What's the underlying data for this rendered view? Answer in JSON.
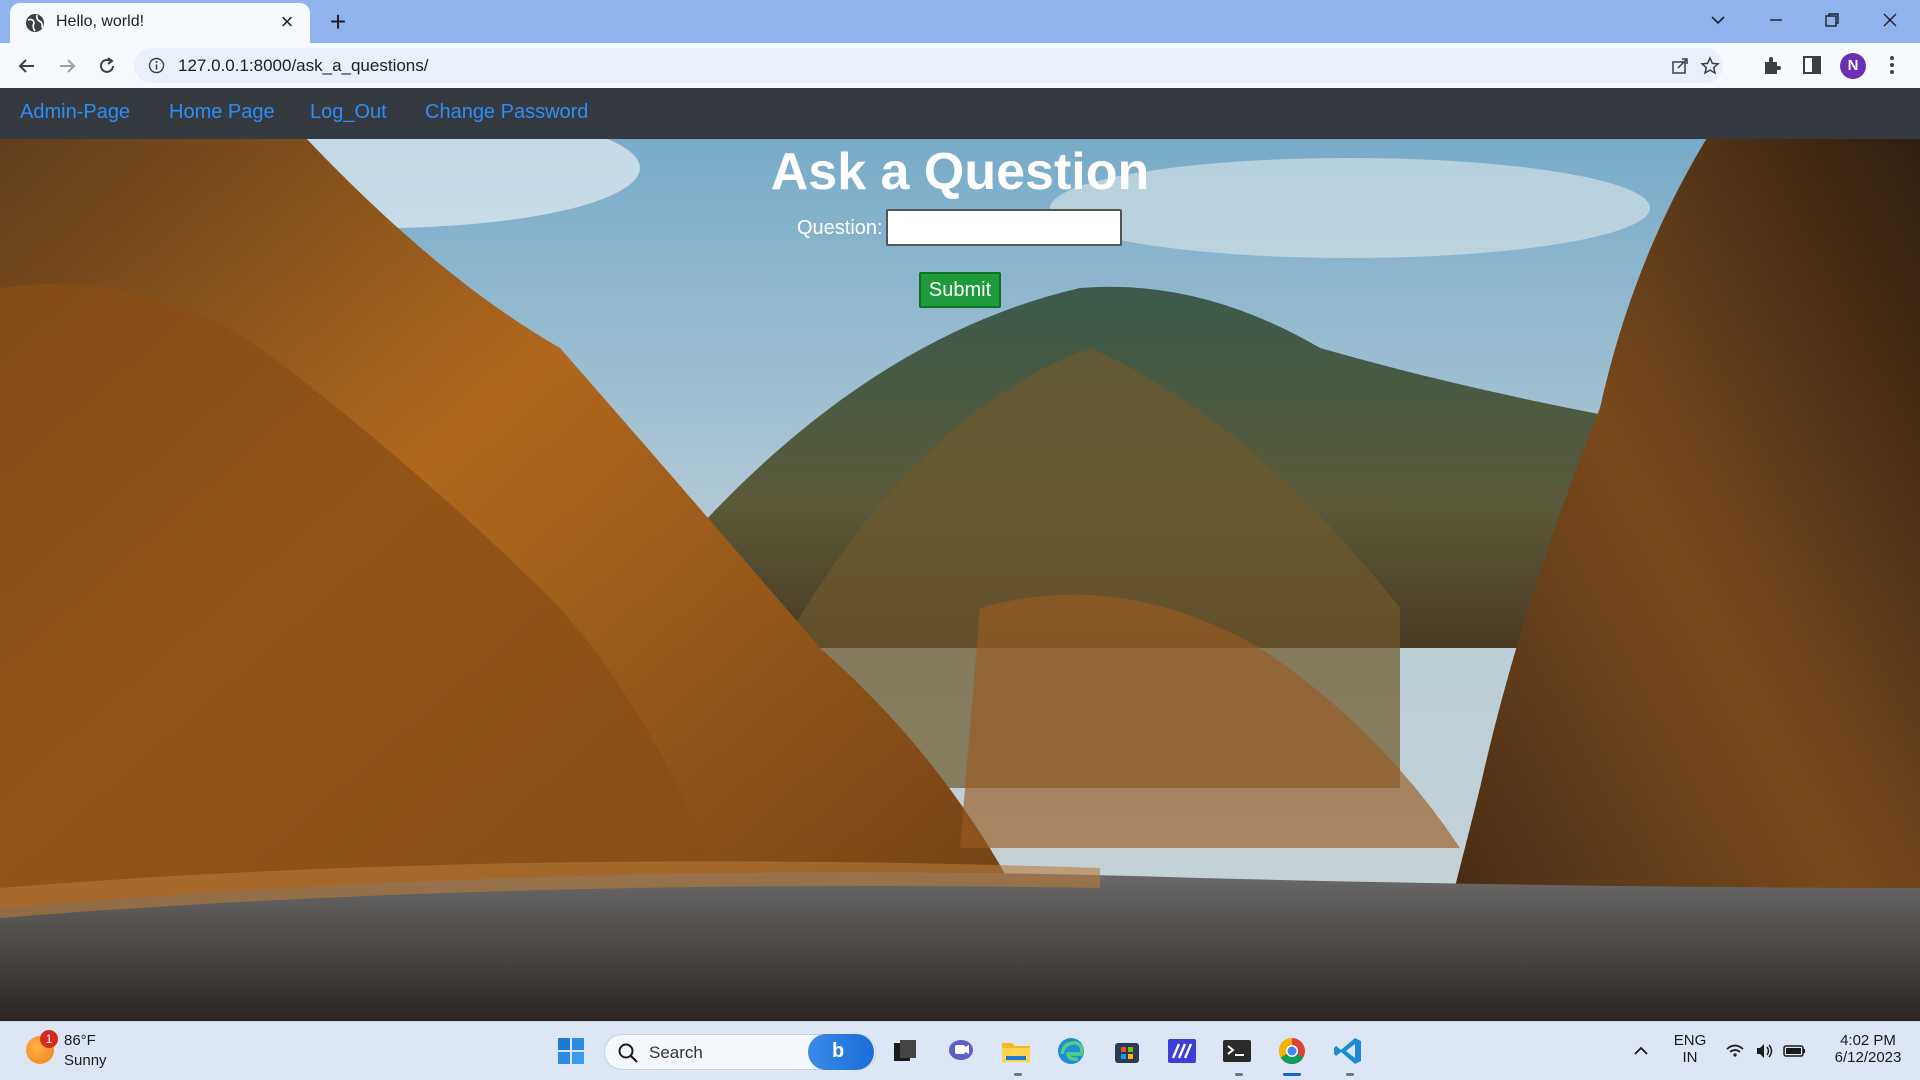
{
  "browser": {
    "tab_title": "Hello, world!",
    "url": "127.0.0.1:8000/ask_a_questions/",
    "profile_initial": "N"
  },
  "site_nav": {
    "links": [
      "Admin-Page",
      "Home Page",
      "Log_Out",
      "Change Password"
    ]
  },
  "form": {
    "title": "Ask a Question",
    "question_label": "Question:",
    "question_value": "",
    "submit_label": "Submit"
  },
  "taskbar": {
    "weather_temp": "86°F",
    "weather_desc": "Sunny",
    "weather_badge": "1",
    "search_label": "Search",
    "language_line1": "ENG",
    "language_line2": "IN",
    "time": "4:02 PM",
    "date": "6/12/2023",
    "pinned_apps": [
      "start-icon",
      "bing-icon",
      "task-view-icon",
      "teams-icon",
      "file-explorer-icon",
      "edge-icon",
      "store-icon",
      "visual-studio-icon",
      "terminal-icon",
      "chrome-icon",
      "vscode-icon"
    ]
  },
  "colors": {
    "nav_bg": "#343a40",
    "nav_link": "#2e8cf5",
    "submit_bg": "#1e9b3c",
    "tab_strip": "#8fb3ec"
  }
}
